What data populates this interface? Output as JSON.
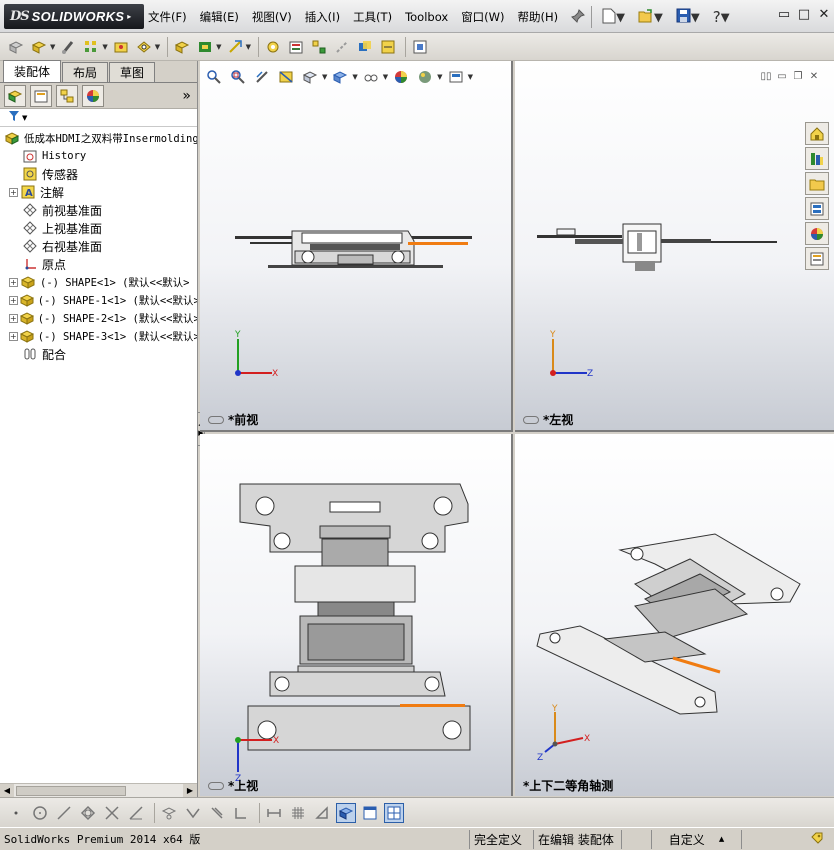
{
  "app": {
    "brand_prefix": "DS",
    "brand_name": "SOLIDWORKS",
    "menu": [
      "文件(F)",
      "编辑(E)",
      "视图(V)",
      "插入(I)",
      "工具(T)",
      "Toolbox",
      "窗口(W)",
      "帮助(H)"
    ]
  },
  "panel": {
    "tabs": [
      "装配体",
      "布局",
      "草图"
    ],
    "more_glyph": "»",
    "tree": {
      "root": "低成本HDMI之双料带Insermolding",
      "items": [
        {
          "label": "History",
          "icon": "history-icon",
          "mono": true
        },
        {
          "label": "传感器",
          "icon": "sensor-icon"
        },
        {
          "label": "注解",
          "icon": "annotation-icon",
          "expandable": true
        },
        {
          "label": "前视基准面",
          "icon": "plane-icon"
        },
        {
          "label": "上视基准面",
          "icon": "plane-icon"
        },
        {
          "label": "右视基准面",
          "icon": "plane-icon"
        },
        {
          "label": "原点",
          "icon": "origin-icon"
        },
        {
          "label": "(-) SHAPE<1> (默认<<默认>",
          "icon": "part-icon",
          "expandable": true,
          "mono": true
        },
        {
          "label": "(-) SHAPE-1<1> (默认<<默认>",
          "icon": "part-icon",
          "expandable": true,
          "mono": true
        },
        {
          "label": "(-) SHAPE-2<1> (默认<<默认>",
          "icon": "part-icon",
          "expandable": true,
          "mono": true
        },
        {
          "label": "(-) SHAPE-3<1> (默认<<默认>",
          "icon": "part-icon",
          "expandable": true,
          "mono": true
        },
        {
          "label": "配合",
          "icon": "mates-icon"
        }
      ]
    }
  },
  "viewports": {
    "front": {
      "label": "*前视",
      "axes": [
        "Y",
        "X"
      ]
    },
    "left": {
      "label": "*左视",
      "axes": [
        "Y",
        "Z"
      ]
    },
    "top": {
      "label": "*上视",
      "axes": [
        "X",
        "Z"
      ]
    },
    "iso": {
      "label": "*上下二等角轴测",
      "axes": [
        "Y",
        "X",
        "Z"
      ]
    }
  },
  "status": {
    "version": "SolidWorks Premium 2014 x64 版",
    "definition": "完全定义",
    "mode": "在编辑 装配体",
    "units": "自定义",
    "units_arrow": "▲"
  },
  "colors": {
    "accent_orange": "#f07c12",
    "part_gray": "#d6d6d6",
    "axis_x": "#d31f1f",
    "axis_y": "#22a022",
    "axis_z": "#2035c8"
  }
}
